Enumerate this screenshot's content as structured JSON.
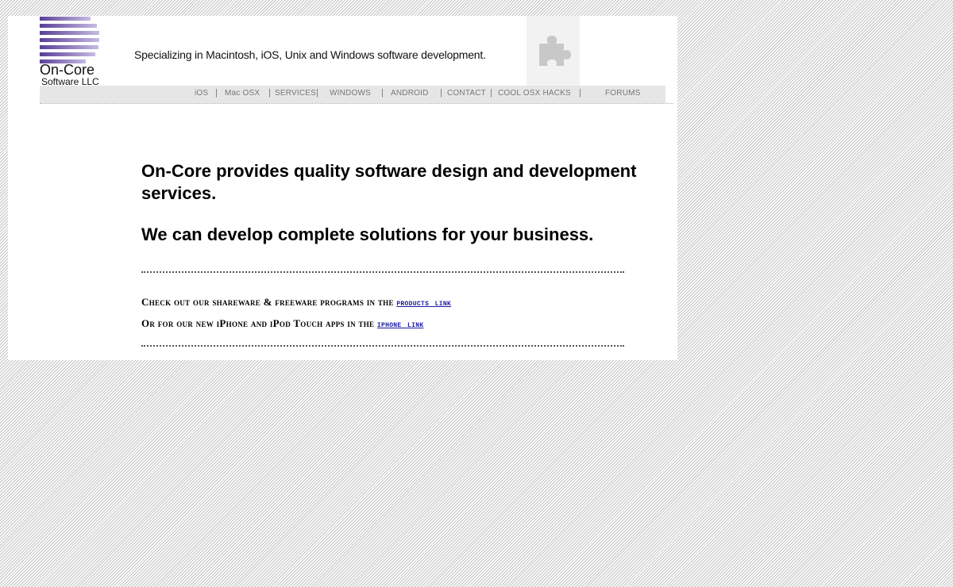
{
  "header": {
    "logo_name": "On-Core",
    "logo_sub": "Software LLC",
    "tagline": "Specializing in Macintosh, iOS, Unix and Windows software development.",
    "plugin_icon": "puzzle-piece-icon"
  },
  "nav": {
    "items": [
      {
        "label": "iOS"
      },
      {
        "label": "Mac OSX"
      },
      {
        "label": "SERVICES"
      },
      {
        "label": "WINDOWS"
      },
      {
        "label": "ANDROID"
      },
      {
        "label": "CONTACT"
      },
      {
        "label": "COOL OSX HACKS"
      },
      {
        "label": "FORUMS"
      }
    ]
  },
  "main": {
    "headline": "On-Core provides quality software design and development services.",
    "subheadline": "We can develop complete solutions for your business.",
    "line1_text": "Check out our shareware & freeware programs in the ",
    "line1_link": "products link",
    "line2_text": "Or for our new iPhone and iPod Touch apps in the ",
    "line2_link": "iphone link"
  },
  "colors": {
    "logo_purple": "#6b4fa3",
    "link_blue": "#1a1aa6",
    "nav_text": "#777777",
    "nav_bg": "#e6e6e6"
  }
}
